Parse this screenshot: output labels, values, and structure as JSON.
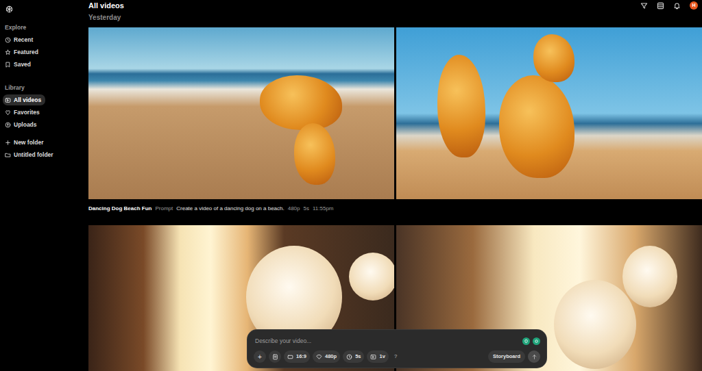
{
  "sidebar": {
    "sections": [
      {
        "label": "Explore",
        "items": [
          {
            "label": "Recent",
            "selected": false
          },
          {
            "label": "Featured",
            "selected": false
          },
          {
            "label": "Saved",
            "selected": false
          }
        ]
      },
      {
        "label": "Library",
        "items": [
          {
            "label": "All videos",
            "selected": true
          },
          {
            "label": "Favorites",
            "selected": false
          },
          {
            "label": "Uploads",
            "selected": false
          }
        ]
      }
    ],
    "folders": [
      {
        "label": "New folder",
        "selected": false
      },
      {
        "label": "Untitled folder",
        "selected": false
      }
    ]
  },
  "header": {
    "title": "All videos",
    "avatar": "H"
  },
  "feed": {
    "group": "Yesterday",
    "video": {
      "title": "Dancing Dog Beach Fun",
      "prompt_label": "Prompt",
      "prompt": "Create a video of a dancing dog on a beach.",
      "resolution": "480p",
      "duration": "5s",
      "time": "11:55pm"
    }
  },
  "composer": {
    "placeholder": "Describe your video...",
    "add": "+",
    "options": [
      {
        "label": "16:9"
      },
      {
        "label": "480p"
      },
      {
        "label": "5s"
      },
      {
        "label": "1v"
      }
    ],
    "help": "?",
    "storyboard": "Storyboard"
  }
}
